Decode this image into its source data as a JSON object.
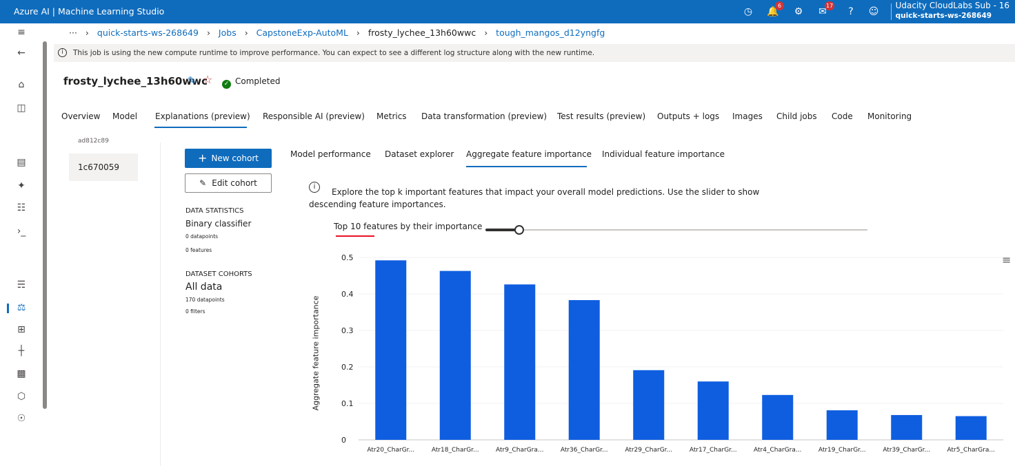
{
  "app": {
    "title": "Azure AI | Machine Learning Studio"
  },
  "topbar": {
    "icons": [
      "clock-icon",
      "bell-icon",
      "gear-icon",
      "feedback-icon",
      "help-icon",
      "smiley-icon"
    ],
    "notifications_count": "6",
    "feedback_count": "17",
    "account_name": "Udacity CloudLabs Sub - 16",
    "workspace": "quick-starts-ws-268649"
  },
  "breadcrumb": {
    "more": "···",
    "items": [
      "quick-starts-ws-268649",
      "Jobs",
      "CapstoneExp-AutoML",
      "frosty_lychee_13h60wwc",
      "tough_mangos_d12yngfg"
    ]
  },
  "notice": "This job is using the new compute runtime to improve performance. You can expect to see a different log structure along with the new runtime.",
  "job": {
    "name": "frosty_lychee_13h60wwc",
    "status": "Completed"
  },
  "tabs": [
    "Overview",
    "Model",
    "Explanations (preview)",
    "Responsible AI (preview)",
    "Metrics",
    "Data transformation (preview)",
    "Test results (preview)",
    "Outputs + logs",
    "Images",
    "Child jobs",
    "Code",
    "Monitoring"
  ],
  "active_tab": "Explanations (preview)",
  "explanations": {
    "id_partial": "ad812c89",
    "id": "1c670059"
  },
  "cohort": {
    "new_label": "New cohort",
    "edit_label": "Edit cohort",
    "data_stats_heading": "DATA STATISTICS",
    "classifier": "Binary classifier",
    "datapoints": "0 datapoints",
    "features": "0 features",
    "cohorts_heading": "DATASET COHORTS",
    "cohort_name": "All data",
    "cohort_datapoints": "170 datapoints",
    "cohort_filters": "0 filters"
  },
  "subtabs": [
    "Model performance",
    "Dataset explorer",
    "Aggregate feature importance",
    "Individual feature importance"
  ],
  "active_subtab": "Aggregate feature importance",
  "info_text_1": "Explore the top k important features that impact your overall model predictions. Use the slider to show",
  "info_text_2": "descending feature importances.",
  "slider": {
    "label": "Top 10 features by their importance",
    "value": 10,
    "max": 96
  },
  "chart_data": {
    "type": "bar",
    "ylabel": "Aggregate feature importance",
    "ylim": [
      0,
      0.5
    ],
    "yticks": [
      "0",
      "0.1",
      "0.2",
      "0.3",
      "0.4",
      "0.5"
    ],
    "categories": [
      "Atr20_CharGr...",
      "Atr18_CharGr...",
      "Atr9_CharGra...",
      "Atr36_CharGr...",
      "Atr29_CharGr...",
      "Atr17_CharGr...",
      "Atr4_CharGra...",
      "Atr19_CharGr...",
      "Atr39_CharGr...",
      "Atr5_CharGra..."
    ],
    "values": [
      0.492,
      0.463,
      0.426,
      0.383,
      0.191,
      0.16,
      0.123,
      0.081,
      0.068,
      0.065
    ],
    "color": "#0f5ee0",
    "grid": true
  }
}
